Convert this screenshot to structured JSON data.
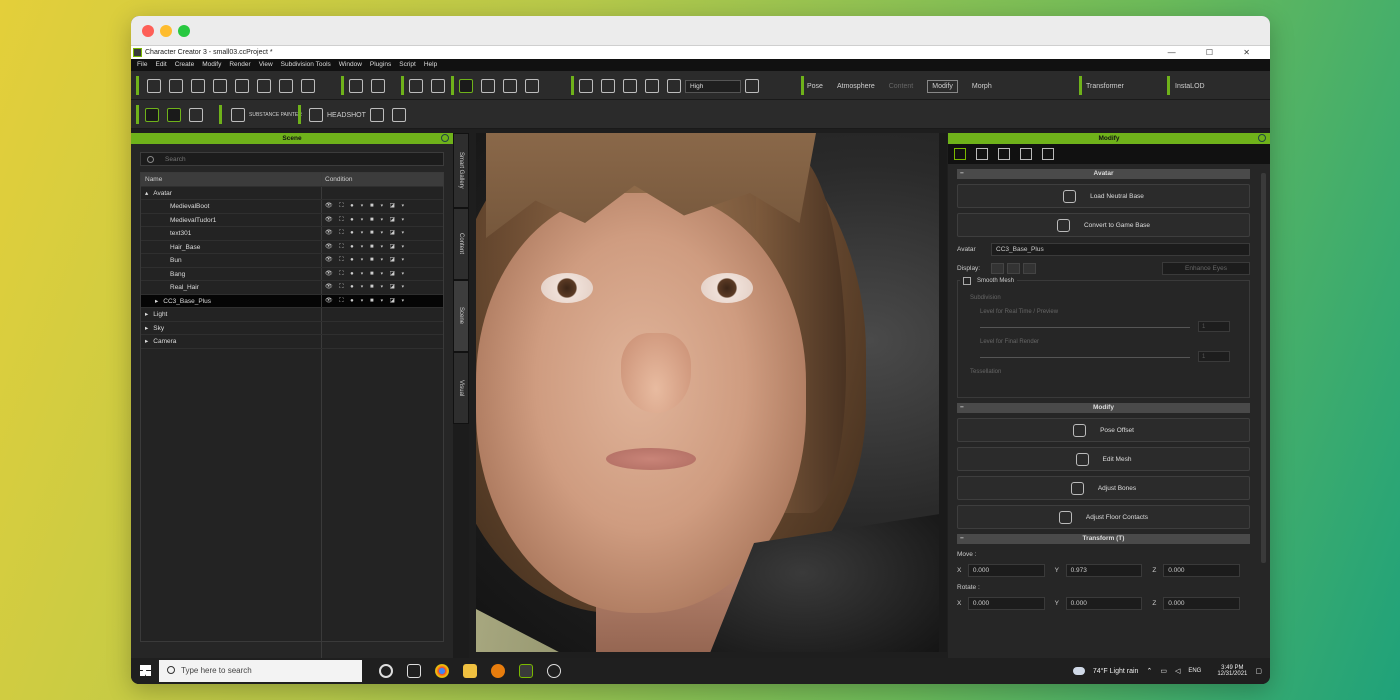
{
  "window": {
    "title": "Character Creator 3 - small03.ccProject *",
    "controls": "— ☐ ✕"
  },
  "menu": [
    "File",
    "Edit",
    "Create",
    "Modify",
    "Render",
    "View",
    "Subdivision Tools",
    "Window",
    "Plugins",
    "Script",
    "Help"
  ],
  "toolbar": {
    "quality": "High",
    "pose": "Pose",
    "atmosphere": "Atmosphere",
    "content": "Content",
    "modify": "Modify",
    "morph": "Morph",
    "transformer": "Transformer",
    "instalod": "InstaLOD",
    "substance": "SUBSTANCE PAINTER",
    "headshot": "HEADSHOT"
  },
  "scene": {
    "title": "Scene",
    "search_placeholder": "Search",
    "col_name": "Name",
    "col_condition": "Condition",
    "rows": [
      {
        "name": "Avatar",
        "indent": 0,
        "expand": "▴",
        "cond": ""
      },
      {
        "name": "MedievalBoot",
        "indent": 2,
        "expand": "",
        "cond": "👁  ⛶  ● ▾  ■ ▾  ◪ ▾"
      },
      {
        "name": "MedievalTudor1",
        "indent": 2,
        "expand": "",
        "cond": "👁  ⛶  ● ▾  ■ ▾  ◪ ▾"
      },
      {
        "name": "text301",
        "indent": 2,
        "expand": "",
        "cond": "👁  ⛶  ● ▾  ■ ▾  ◪ ▾"
      },
      {
        "name": "Hair_Base",
        "indent": 2,
        "expand": "",
        "cond": "👁  ⛶  ● ▾  ■ ▾  ◪ ▾"
      },
      {
        "name": "Bun",
        "indent": 2,
        "expand": "",
        "cond": "👁  ⛶  ● ▾  ■ ▾  ◪ ▾"
      },
      {
        "name": "Bang",
        "indent": 2,
        "expand": "",
        "cond": "👁  ⛶  ● ▾  ■ ▾  ◪ ▾"
      },
      {
        "name": "Real_Hair",
        "indent": 2,
        "expand": "",
        "cond": "👁  ⛶  ● ▾  ■ ▾  ◪ ▾"
      },
      {
        "name": "CC3_Base_Plus",
        "indent": 1,
        "expand": "▸",
        "cond": "👁  ⛶  ● ▾  ■ ▾  ◪ ▾",
        "selected": true
      },
      {
        "name": "Light",
        "indent": 0,
        "expand": "▸",
        "cond": ""
      },
      {
        "name": "Sky",
        "indent": 0,
        "expand": "▸",
        "cond": ""
      },
      {
        "name": "Camera",
        "indent": 0,
        "expand": "▸",
        "cond": ""
      }
    ]
  },
  "vtabs": [
    "Smart Gallery",
    "Content",
    "Scene",
    "Visual"
  ],
  "modify": {
    "title": "Modify",
    "avatar_section": "Avatar",
    "load_neutral": "Load Neutral Base",
    "convert_game": "Convert to Game Base",
    "avatar_label": "Avatar",
    "avatar_value": "CC3_Base_Plus",
    "display_label": "Display:",
    "enhance_eyes": "Enhance Eyes",
    "smooth_mesh": "Smooth Mesh",
    "subdivision": "Subdivision",
    "level_realtime": "Level for Real Time / Preview",
    "level_final": "Level for Final Render",
    "level_realtime_value": "1",
    "level_final_value": "1",
    "tessellation": "Tessellation",
    "modify_section": "Modify",
    "pose_offset": "Pose Offset",
    "edit_mesh": "Edit Mesh",
    "adjust_bones": "Adjust Bones",
    "adjust_floor": "Adjust Floor Contacts",
    "transform_section": "Transform  (T)",
    "move_label": "Move :",
    "rotate_label": "Rotate :",
    "move": {
      "x": "0.000",
      "y": "0.973",
      "z": "0.000"
    },
    "rotate": {
      "x": "0.000",
      "y": "0.000",
      "z": "0.000"
    }
  },
  "taskbar": {
    "search_placeholder": "Type here to search",
    "weather": "74°F  Light rain",
    "lang": "ENG",
    "time": "3:49 PM",
    "date": "12/31/2021"
  }
}
